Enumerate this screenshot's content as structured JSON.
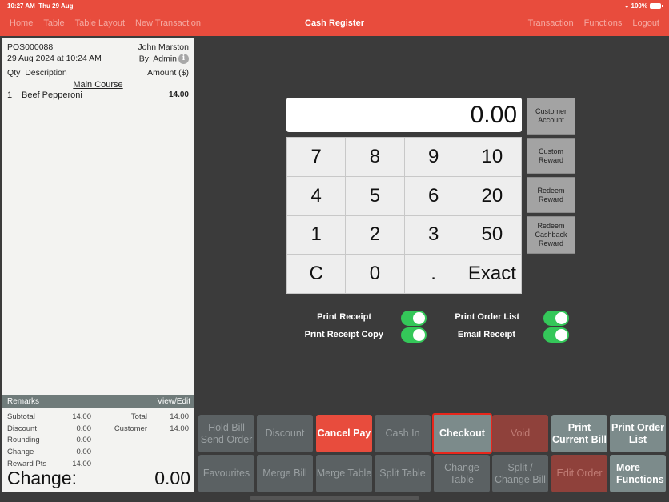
{
  "status_bar": {
    "time": "10:27 AM",
    "date": "Thu 29 Aug",
    "battery": "100%"
  },
  "header": {
    "title": "Cash Register",
    "nav_left": [
      "Home",
      "Table",
      "Table Layout",
      "New Transaction"
    ],
    "nav_right": [
      "Transaction",
      "Functions",
      "Logout"
    ]
  },
  "receipt": {
    "order_no": "POS000088",
    "customer": "John Marston",
    "datetime": "29 Aug 2024 at 10:24 AM",
    "by": "By: Admin",
    "col_qty": "Qty",
    "col_desc": "Description",
    "col_amount": "Amount ($)",
    "course": "Main Course",
    "items": [
      {
        "qty": "1",
        "desc": "Beef Pepperoni",
        "amount": "14.00"
      }
    ],
    "remarks_label": "Remarks",
    "remarks_action": "View/Edit",
    "totals": [
      {
        "label": "Subtotal",
        "value": "14.00",
        "label2": "Total",
        "value2": "14.00"
      },
      {
        "label": "Discount",
        "value": "0.00",
        "label2": "Customer",
        "value2": "14.00"
      },
      {
        "label": "Rounding",
        "value": "0.00",
        "label2": "",
        "value2": ""
      },
      {
        "label": "Change",
        "value": "0.00",
        "label2": "",
        "value2": ""
      },
      {
        "label": "Reward Pts",
        "value": "14.00",
        "label2": "",
        "value2": ""
      }
    ],
    "change_label": "Change:",
    "change_value": "0.00"
  },
  "keypad": {
    "display": "0.00",
    "keys": [
      "7",
      "8",
      "9",
      "10",
      "4",
      "5",
      "6",
      "20",
      "1",
      "2",
      "3",
      "50",
      "C",
      "0",
      ".",
      "Exact"
    ]
  },
  "side_buttons": [
    "Customer\nAccount",
    "Custom\nReward",
    "Redeem\nReward",
    "Redeem\nCashback\nReward"
  ],
  "toggles": [
    {
      "label": "Print Receipt",
      "on": true
    },
    {
      "label": "Print Order List",
      "on": true
    },
    {
      "label": "Print Receipt Copy",
      "on": true
    },
    {
      "label": "Email Receipt",
      "on": true
    }
  ],
  "actions": [
    {
      "label": "Hold Bill\nSend Order",
      "style": "gray"
    },
    {
      "label": "Discount",
      "style": "gray"
    },
    {
      "label": "Cancel Pay",
      "style": "red"
    },
    {
      "label": "Cash In",
      "style": "gray"
    },
    {
      "label": "Checkout",
      "style": "checkout"
    },
    {
      "label": "Void",
      "style": "darkred"
    },
    {
      "label": "Print\nCurrent Bill",
      "style": "light"
    },
    {
      "label": "Print Order\nList",
      "style": "light"
    },
    {
      "label": "Favourites",
      "style": "gray"
    },
    {
      "label": "Merge Bill",
      "style": "gray"
    },
    {
      "label": "Merge Table",
      "style": "gray"
    },
    {
      "label": "Split Table",
      "style": "gray"
    },
    {
      "label": "Change\nTable",
      "style": "gray"
    },
    {
      "label": "Split /\nChange Bill",
      "style": "gray"
    },
    {
      "label": "Edit Order",
      "style": "darkred"
    },
    {
      "label": "More\nFunctions",
      "style": "light"
    }
  ],
  "colors": {
    "brand": "#e84c3d",
    "toggle_on": "#34c759",
    "checkout_outline": "#e8261b"
  }
}
